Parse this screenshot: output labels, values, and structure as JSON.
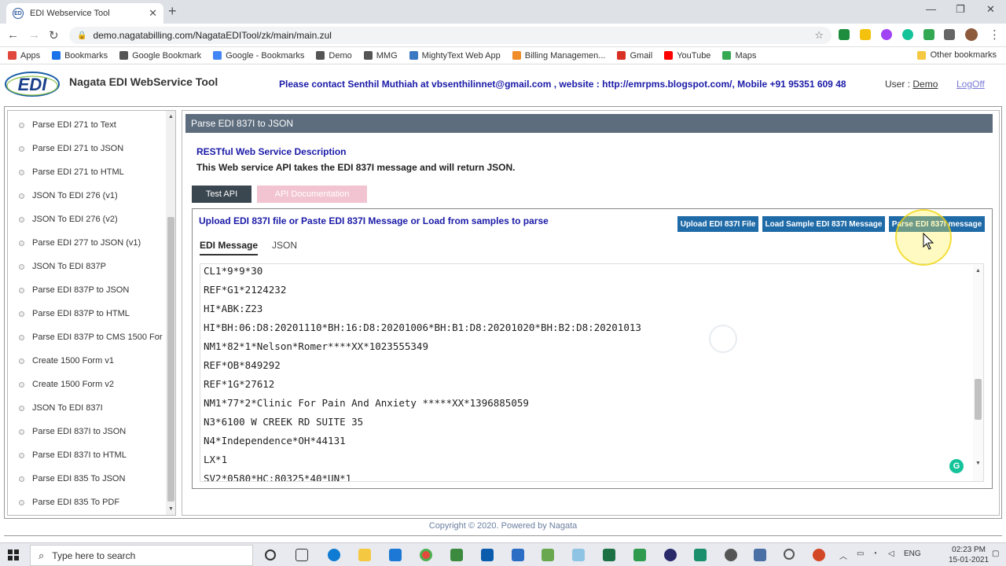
{
  "browser": {
    "tab_title": "EDI Webservice Tool",
    "url": "demo.nagatabilling.com/NagataEDITool/zk/main/main.zul",
    "bookmarks": [
      {
        "label": "Apps",
        "icon": "apps-icon",
        "color": "#e0483e"
      },
      {
        "label": "Bookmarks",
        "icon": "star-icon",
        "color": "#1a73e8"
      },
      {
        "label": "Google Bookmark",
        "icon": "globe-icon",
        "color": "#555555"
      },
      {
        "label": "Google - Bookmarks",
        "icon": "google-icon",
        "color": "#4285f4"
      },
      {
        "label": "Demo",
        "icon": "globe-icon",
        "color": "#555555"
      },
      {
        "label": "MMG",
        "icon": "globe-icon",
        "color": "#555555"
      },
      {
        "label": "MightyText Web App",
        "icon": "mightytext-icon",
        "color": "#3a78c2"
      },
      {
        "label": "Billing Managemen...",
        "icon": "billing-icon",
        "color": "#f08c2a"
      },
      {
        "label": "Gmail",
        "icon": "gmail-icon",
        "color": "#d93025"
      },
      {
        "label": "YouTube",
        "icon": "youtube-icon",
        "color": "#ff0000"
      },
      {
        "label": "Maps",
        "icon": "maps-icon",
        "color": "#34a853"
      }
    ],
    "other_bookmarks": "Other bookmarks"
  },
  "header": {
    "logo_text": "EDI",
    "title": "Nagata EDI WebService Tool",
    "contact": "Please contact Senthil Muthiah at vbsenthilinnet@gmail.com , website : http://emrpms.blogspot.com/, Mobile +91 95351 609 48",
    "user_label": "User :",
    "user_name": "Demo",
    "logoff": "LogOff"
  },
  "sidebar": {
    "items": [
      "Parse EDI 271 to Text",
      "Parse EDI 271 to JSON",
      "Parse EDI 271 to HTML",
      "JSON To EDI 276 (v1)",
      "JSON To EDI 276 (v2)",
      "Parse EDI 277 to JSON (v1)",
      "JSON To EDI 837P",
      "Parse EDI 837P to JSON",
      "Parse EDI 837P to HTML",
      "Parse EDI 837P to CMS 1500 For",
      "Create 1500 Form v1",
      "Create 1500 Form v2",
      "JSON To EDI 837I",
      "Parse EDI 837I to JSON",
      "Parse EDI 837I to HTML",
      "Parse EDI 835 To JSON",
      "Parse EDI 835 To PDF"
    ]
  },
  "main": {
    "panel_title": "Parse EDI 837I to JSON",
    "rest_title": "RESTful Web Service Description",
    "rest_desc": "This Web service API takes the EDI 837I message and will return JSON.",
    "btn_test": "Test API",
    "btn_apidoc": "API Documentation",
    "upload_title": "Upload EDI 837I file or Paste EDI 837I Message or Load from samples to parse",
    "btn_upload": "Upload EDI 837I File",
    "btn_load_sample": "Load Sample EDI 837I Message",
    "btn_parse": "Parse EDI 837I message",
    "tab_edi": "EDI Message",
    "tab_json": "JSON",
    "editor_lines": [
      "CL1*9*9*30",
      "REF*G1*2124232",
      "HI*ABK:Z23",
      "HI*BH:06:D8:20201110*BH:16:D8:20201006*BH:B1:D8:20201020*BH:B2:D8:20201013",
      "NM1*82*1*Nelson*Romer****XX*1023555349",
      "REF*OB*849292",
      "REF*1G*27612",
      "NM1*77*2*Clinic For Pain And Anxiety *****XX*1396885059",
      "N3*6100 W CREEK RD SUITE 35",
      "N4*Independence*OH*44131",
      "LX*1",
      "SV2*0580*HC:80325*40*UN*1"
    ]
  },
  "footer": {
    "copyright": "Copyright © 2020. Powered by Nagata"
  },
  "taskbar": {
    "search_placeholder": "Type here to search",
    "lang": "ENG",
    "time": "02:23 PM",
    "date": "15-01-2021"
  }
}
